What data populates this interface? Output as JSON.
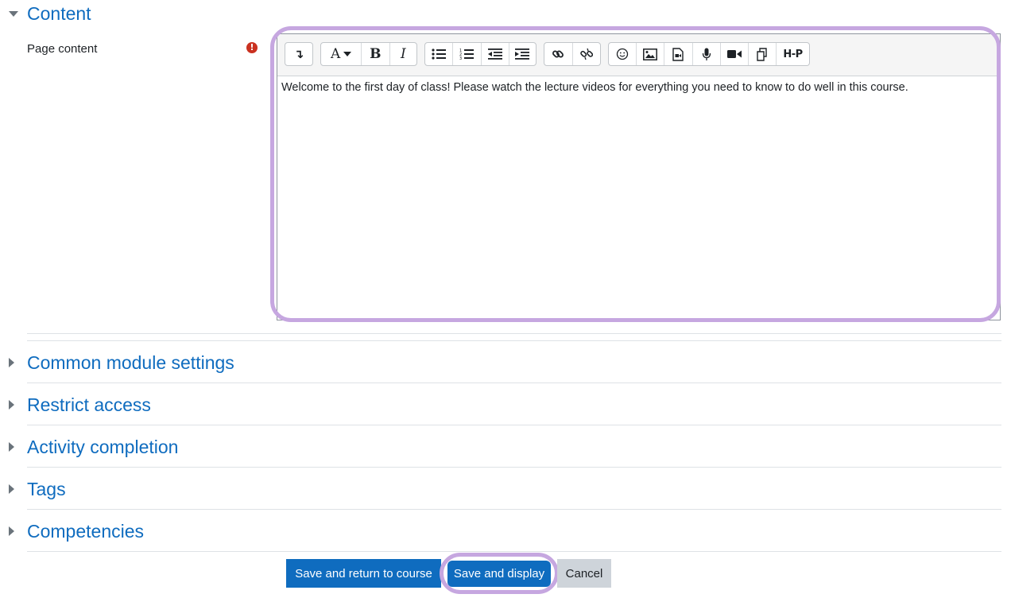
{
  "sections": {
    "content": "Content",
    "common_module_settings": "Common module settings",
    "restrict_access": "Restrict access",
    "activity_completion": "Activity completion",
    "tags": "Tags",
    "competencies": "Competencies"
  },
  "field": {
    "label": "Page content",
    "required_icon": "!"
  },
  "toolbar": {
    "collapse": "↴",
    "paragraph_style": "A",
    "bold": "B",
    "italic": "I",
    "h5p": "H-P"
  },
  "editor": {
    "content": "Welcome to the first day of class! Please watch the lecture videos for everything you need to know to do well in this course."
  },
  "buttons": {
    "save_return": "Save and return to course",
    "save_display": "Save and display",
    "cancel": "Cancel"
  },
  "colors": {
    "link": "#0f6cbf",
    "primary_button": "#0f6cbf",
    "secondary_button": "#ced4da",
    "highlight": "#c6a7e0",
    "required": "#ca3120"
  }
}
